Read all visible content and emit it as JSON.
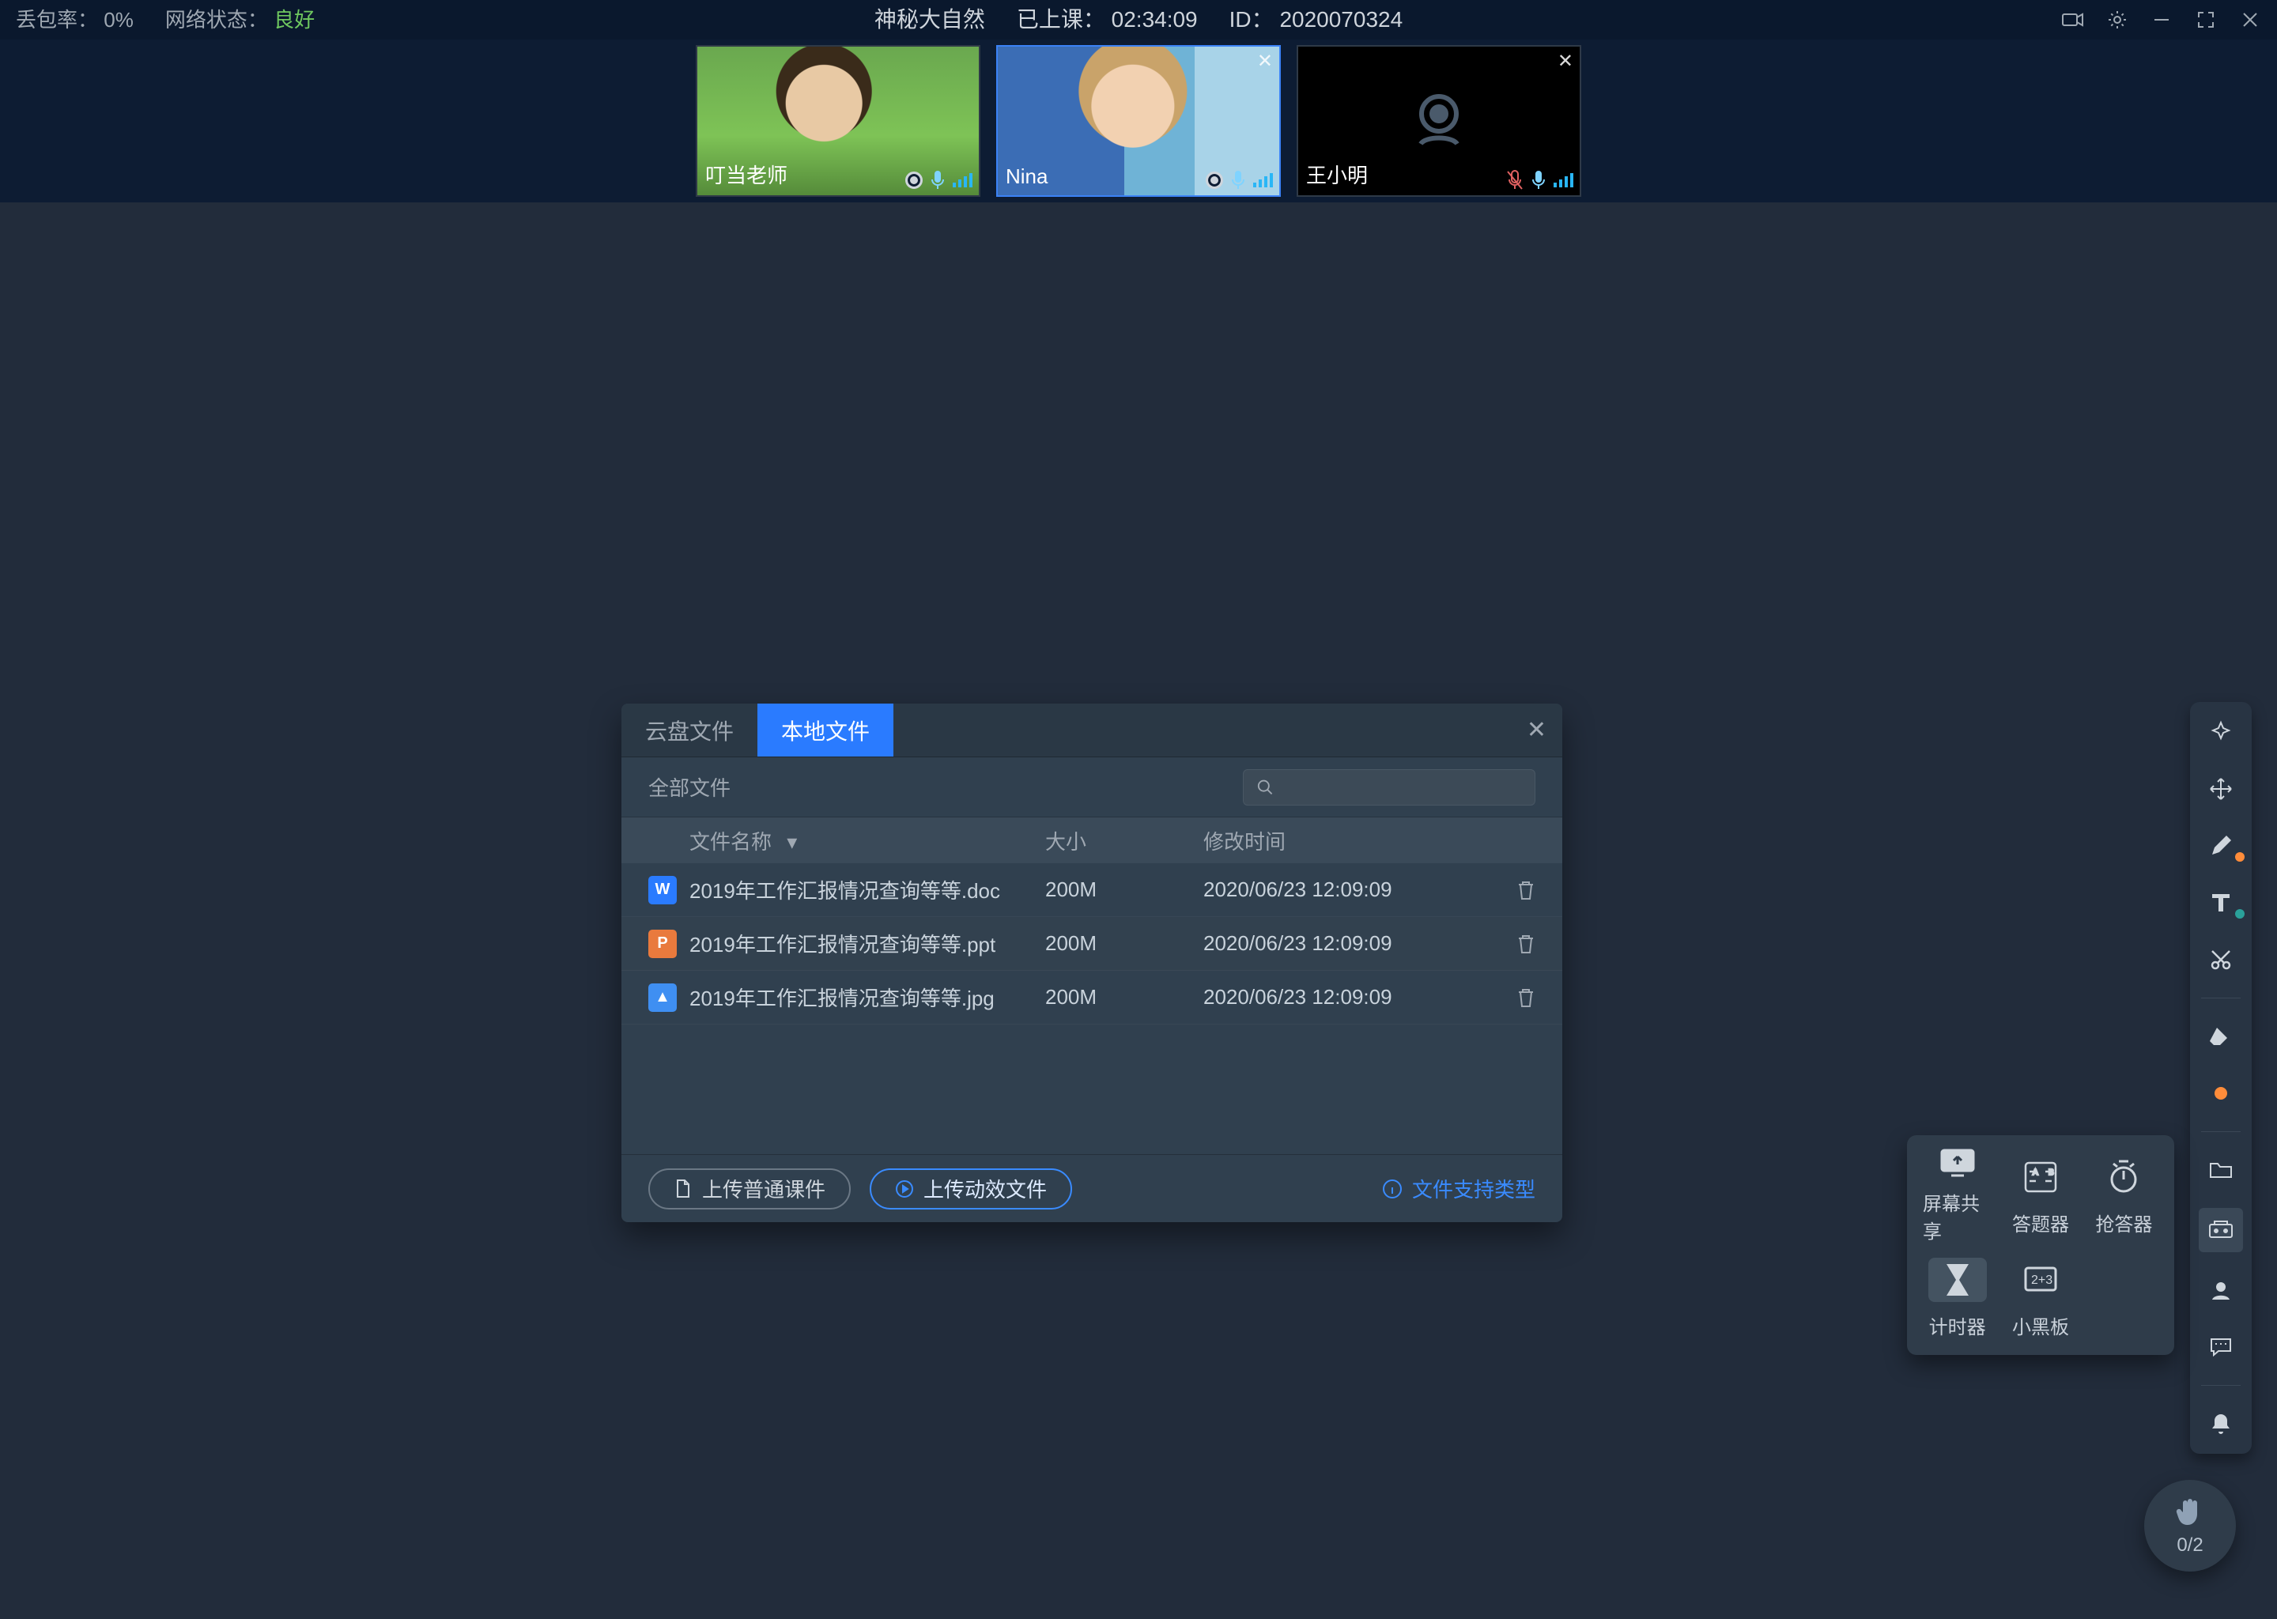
{
  "topbar": {
    "packet_loss_label": "丢包率：",
    "packet_loss_value": "0%",
    "net_label": "网络状态：",
    "net_value": "良好",
    "title": "神秘大自然",
    "elapsed_label": "已上课：",
    "elapsed_value": "02:34:09",
    "id_label": "ID：",
    "id_value": "2020070324"
  },
  "cams": [
    {
      "name": "叮当老师",
      "close": false
    },
    {
      "name": "Nina",
      "close": true
    },
    {
      "name": "王小明",
      "close": true
    }
  ],
  "dialog": {
    "tab_cloud": "云盘文件",
    "tab_local": "本地文件",
    "all_files": "全部文件",
    "col_name": "文件名称",
    "col_size": "大小",
    "col_modified": "修改时间",
    "rows": [
      {
        "icon": "W",
        "cls": "fic-doc",
        "name": "2019年工作汇报情况查询等等.doc",
        "size": "200M",
        "modified": "2020/06/23 12:09:09"
      },
      {
        "icon": "P",
        "cls": "fic-ppt",
        "name": "2019年工作汇报情况查询等等.ppt",
        "size": "200M",
        "modified": "2020/06/23 12:09:09"
      },
      {
        "icon": "▲",
        "cls": "fic-jpg",
        "name": "2019年工作汇报情况查询等等.jpg",
        "size": "200M",
        "modified": "2020/06/23 12:09:09"
      }
    ],
    "btn_upload_normal": "上传普通课件",
    "btn_upload_dyn": "上传动效文件",
    "file_types": "文件支持类型"
  },
  "pop": {
    "screen_share": "屏幕共享",
    "answer": "答题器",
    "rush": "抢答器",
    "timer": "计时器",
    "board": "小黑板"
  },
  "hand": {
    "count": "0/2"
  }
}
